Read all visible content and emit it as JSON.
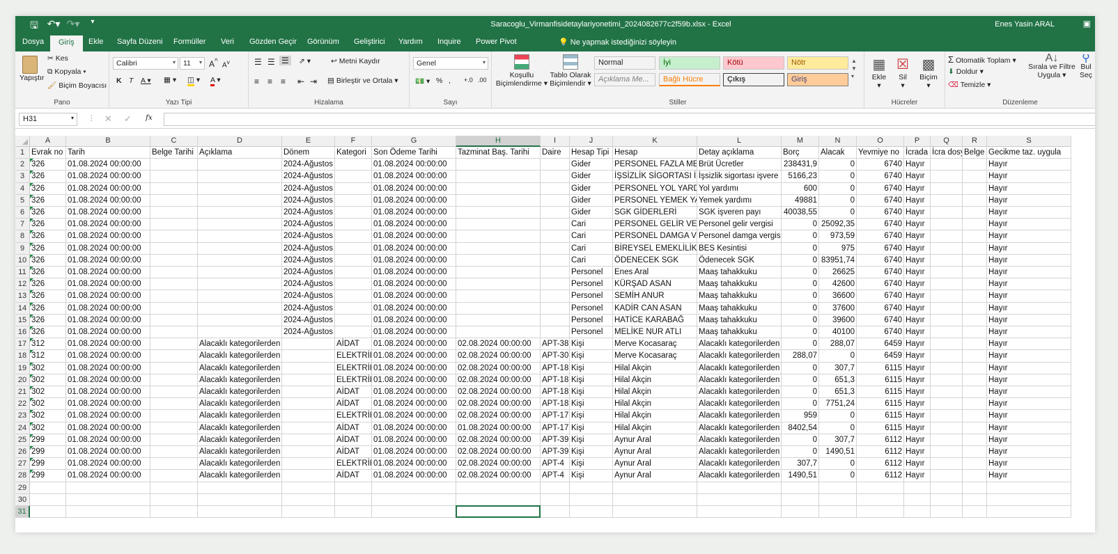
{
  "titlebar": {
    "file_name": "Saracoglu_Virmanfisidetaylariyonetimi_2024082677c2f59b.xlsx  -  Excel",
    "user": "Enes Yasin ARAL"
  },
  "tabs": [
    "Dosya",
    "Giriş",
    "Ekle",
    "Sayfa Düzeni",
    "Formüller",
    "Veri",
    "Gözden Geçir",
    "Görünüm",
    "Geliştirici",
    "Yardım",
    "Inquire",
    "Power Pivot"
  ],
  "active_tab": "Giriş",
  "tell_me": "Ne yapmak istediğinizi söyleyin",
  "ribbon": {
    "clipboard": {
      "paste": "Yapıştır",
      "cut": "Kes",
      "copy": "Kopyala",
      "format_painter": "Biçim Boyacısı",
      "label": "Pano"
    },
    "font": {
      "name": "Calibri",
      "size": "11",
      "label": "Yazı Tipi"
    },
    "alignment": {
      "wrap": "Metni Kaydır",
      "merge": "Birleştir ve Ortala",
      "label": "Hizalama"
    },
    "number": {
      "format": "Genel",
      "label": "Sayı"
    },
    "styles": {
      "conditional": "Koşullu Biçimlendirme",
      "table": "Tablo Olarak Biçimlendir",
      "cells": [
        {
          "text": "Normal",
          "bg": "#ffffff",
          "color": "#000000"
        },
        {
          "text": "İyi",
          "bg": "#c6efce",
          "color": "#006100"
        },
        {
          "text": "Kötü",
          "bg": "#ffc7ce",
          "color": "#9c0006"
        },
        {
          "text": "Nötr",
          "bg": "#ffeb9c",
          "color": "#9c5700"
        },
        {
          "text": "Açıklama Me...",
          "bg": "#ffffff",
          "color": "#7f7f7f"
        },
        {
          "text": "Bağlı Hücre",
          "bg": "#ffffff",
          "color": "#fa7d00"
        },
        {
          "text": "Çıkış",
          "bg": "#f2f2f2",
          "color": "#3f3f3f"
        },
        {
          "text": "Giriş",
          "bg": "#ffcc99",
          "color": "#3f3f76"
        }
      ],
      "label": "Stiller"
    },
    "cells_group": {
      "insert": "Ekle",
      "delete": "Sil",
      "format": "Biçim",
      "label": "Hücreler"
    },
    "editing": {
      "autosum": "Otomatik Toplam",
      "fill": "Doldur",
      "clear": "Temizle",
      "sort": "Sırala ve Filtre Uygula",
      "find": "Bul Seç",
      "label": "Düzenleme"
    }
  },
  "formula_bar": {
    "name_box": "H31",
    "fx": "fx",
    "value": ""
  },
  "sheet": {
    "columns": [
      "A",
      "B",
      "C",
      "D",
      "E",
      "F",
      "G",
      "H",
      "I",
      "J",
      "K",
      "L",
      "M",
      "N",
      "O",
      "P",
      "Q",
      "R",
      "S"
    ],
    "selected_column": "H",
    "selected_row": 31,
    "header_row": [
      "Evrak no",
      "Tarih",
      "Belge Tarihi",
      "Açıklama",
      "Dönem",
      "Kategori",
      "Son Ödeme Tarihi",
      "Tazminat Baş. Tarihi",
      "Daire",
      "Hesap Tipi",
      "Hesap",
      "Detay açıklama",
      "Borç",
      "Alacak",
      "Yevmiye no",
      "İcrada",
      "İcra dosy",
      "Belge",
      "Gecikme taz. uygula"
    ],
    "rows": [
      [
        "326",
        "01.08.2024 00:00:00",
        "",
        "",
        "2024-Ağustos",
        "",
        "01.08.2024 00:00:00",
        "",
        "",
        "Gider",
        "PERSONEL FAZLA MESA",
        "Brüt Ücretler",
        "238431,9",
        "0",
        "6740",
        "Hayır",
        "",
        "",
        "Hayır"
      ],
      [
        "326",
        "01.08.2024 00:00:00",
        "",
        "",
        "2024-Ağustos",
        "",
        "01.08.2024 00:00:00",
        "",
        "",
        "Gider",
        "İŞSİZLİK SİGORTASI İŞV",
        "İşsizlik sigortası işvere",
        "5166,23",
        "0",
        "6740",
        "Hayır",
        "",
        "",
        "Hayır"
      ],
      [
        "326",
        "01.08.2024 00:00:00",
        "",
        "",
        "2024-Ağustos",
        "",
        "01.08.2024 00:00:00",
        "",
        "",
        "Gider",
        "PERSONEL YOL YARDIM",
        "Yol yardımı",
        "600",
        "0",
        "6740",
        "Hayır",
        "",
        "",
        "Hayır"
      ],
      [
        "326",
        "01.08.2024 00:00:00",
        "",
        "",
        "2024-Ağustos",
        "",
        "01.08.2024 00:00:00",
        "",
        "",
        "Gider",
        "PERSONEL YEMEK YAR",
        "Yemek yardımı",
        "49881",
        "0",
        "6740",
        "Hayır",
        "",
        "",
        "Hayır"
      ],
      [
        "326",
        "01.08.2024 00:00:00",
        "",
        "",
        "2024-Ağustos",
        "",
        "01.08.2024 00:00:00",
        "",
        "",
        "Gider",
        "SGK GİDERLERİ",
        "SGK işveren payı",
        "40038,55",
        "0",
        "6740",
        "Hayır",
        "",
        "",
        "Hayır"
      ],
      [
        "326",
        "01.08.2024 00:00:00",
        "",
        "",
        "2024-Ağustos",
        "",
        "01.08.2024 00:00:00",
        "",
        "",
        "Cari",
        "PERSONEL GELİR VERG",
        "Personel gelir vergisi",
        "0",
        "25092,35",
        "6740",
        "Hayır",
        "",
        "",
        "Hayır"
      ],
      [
        "326",
        "01.08.2024 00:00:00",
        "",
        "",
        "2024-Ağustos",
        "",
        "01.08.2024 00:00:00",
        "",
        "",
        "Cari",
        "PERSONEL DAMGA VEF",
        "Personel damga vergis",
        "0",
        "973,59",
        "6740",
        "Hayır",
        "",
        "",
        "Hayır"
      ],
      [
        "326",
        "01.08.2024 00:00:00",
        "",
        "",
        "2024-Ağustos",
        "",
        "01.08.2024 00:00:00",
        "",
        "",
        "Cari",
        "BİREYSEL EMEKLİLİK Sİ",
        "BES Kesintisi",
        "0",
        "975",
        "6740",
        "Hayır",
        "",
        "",
        "Hayır"
      ],
      [
        "326",
        "01.08.2024 00:00:00",
        "",
        "",
        "2024-Ağustos",
        "",
        "01.08.2024 00:00:00",
        "",
        "",
        "Cari",
        "ÖDENECEK SGK",
        "Ödenecek SGK",
        "0",
        "83951,74",
        "6740",
        "Hayır",
        "",
        "",
        "Hayır"
      ],
      [
        "326",
        "01.08.2024 00:00:00",
        "",
        "",
        "2024-Ağustos",
        "",
        "01.08.2024 00:00:00",
        "",
        "",
        "Personel",
        "Enes Aral",
        "Maaş tahakkuku",
        "0",
        "26625",
        "6740",
        "Hayır",
        "",
        "",
        "Hayır"
      ],
      [
        "326",
        "01.08.2024 00:00:00",
        "",
        "",
        "2024-Ağustos",
        "",
        "01.08.2024 00:00:00",
        "",
        "",
        "Personel",
        "KÜRŞAD ASAN",
        "Maaş tahakkuku",
        "0",
        "42600",
        "6740",
        "Hayır",
        "",
        "",
        "Hayır"
      ],
      [
        "326",
        "01.08.2024 00:00:00",
        "",
        "",
        "2024-Ağustos",
        "",
        "01.08.2024 00:00:00",
        "",
        "",
        "Personel",
        "SEMİH ANUR",
        "Maaş tahakkuku",
        "0",
        "36600",
        "6740",
        "Hayır",
        "",
        "",
        "Hayır"
      ],
      [
        "326",
        "01.08.2024 00:00:00",
        "",
        "",
        "2024-Ağustos",
        "",
        "01.08.2024 00:00:00",
        "",
        "",
        "Personel",
        "KADİR CAN ASAN",
        "Maaş tahakkuku",
        "0",
        "37600",
        "6740",
        "Hayır",
        "",
        "",
        "Hayır"
      ],
      [
        "326",
        "01.08.2024 00:00:00",
        "",
        "",
        "2024-Ağustos",
        "",
        "01.08.2024 00:00:00",
        "",
        "",
        "Personel",
        "HATİCE KARABAĞ",
        "Maaş tahakkuku",
        "0",
        "39600",
        "6740",
        "Hayır",
        "",
        "",
        "Hayır"
      ],
      [
        "326",
        "01.08.2024 00:00:00",
        "",
        "",
        "2024-Ağustos",
        "",
        "01.08.2024 00:00:00",
        "",
        "",
        "Personel",
        "MELİKE NUR ATLI",
        "Maaş tahakkuku",
        "0",
        "40100",
        "6740",
        "Hayır",
        "",
        "",
        "Hayır"
      ],
      [
        "312",
        "01.08.2024 00:00:00",
        "",
        "Alacaklı kategorilerden",
        "",
        "AİDAT",
        "01.08.2024 00:00:00",
        "02.08.2024 00:00:00",
        "APT-38",
        "Kişi",
        "Merve Kocasaraç",
        "Alacaklı kategorilerden",
        "0",
        "288,07",
        "6459",
        "Hayır",
        "",
        "",
        "Hayır"
      ],
      [
        "312",
        "01.08.2024 00:00:00",
        "",
        "Alacaklı kategorilerden",
        "",
        "ELEKTRİK",
        "01.08.2024 00:00:00",
        "02.08.2024 00:00:00",
        "APT-30",
        "Kişi",
        "Merve Kocasaraç",
        "Alacaklı kategorilerden",
        "288,07",
        "0",
        "6459",
        "Hayır",
        "",
        "",
        "Hayır"
      ],
      [
        "302",
        "01.08.2024 00:00:00",
        "",
        "Alacaklı kategorilerden",
        "",
        "ELEKTRİK",
        "01.08.2024 00:00:00",
        "02.08.2024 00:00:00",
        "APT-18",
        "Kişi",
        "Hilal Akçin",
        "Alacaklı kategorilerden",
        "0",
        "307,7",
        "6115",
        "Hayır",
        "",
        "",
        "Hayır"
      ],
      [
        "302",
        "01.08.2024 00:00:00",
        "",
        "Alacaklı kategorilerden",
        "",
        "ELEKTRİK",
        "01.08.2024 00:00:00",
        "02.08.2024 00:00:00",
        "APT-18",
        "Kişi",
        "Hilal Akçin",
        "Alacaklı kategorilerden",
        "0",
        "651,3",
        "6115",
        "Hayır",
        "",
        "",
        "Hayır"
      ],
      [
        "302",
        "01.08.2024 00:00:00",
        "",
        "Alacaklı kategorilerden",
        "",
        "AİDAT",
        "01.08.2024 00:00:00",
        "02.08.2024 00:00:00",
        "APT-18",
        "Kişi",
        "Hilal Akçin",
        "Alacaklı kategorilerden",
        "0",
        "651,3",
        "6115",
        "Hayır",
        "",
        "",
        "Hayır"
      ],
      [
        "302",
        "01.08.2024 00:00:00",
        "",
        "Alacaklı kategorilerden",
        "",
        "AİDAT",
        "01.08.2024 00:00:00",
        "02.08.2024 00:00:00",
        "APT-18",
        "Kişi",
        "Hilal Akçin",
        "Alacaklı kategorilerden",
        "0",
        "7751,24",
        "6115",
        "Hayır",
        "",
        "",
        "Hayır"
      ],
      [
        "302",
        "01.08.2024 00:00:00",
        "",
        "Alacaklı kategorilerden",
        "",
        "ELEKTRİK",
        "01.08.2024 00:00:00",
        "02.08.2024 00:00:00",
        "APT-17",
        "Kişi",
        "Hilal Akçin",
        "Alacaklı kategorilerden",
        "959",
        "0",
        "6115",
        "Hayır",
        "",
        "",
        "Hayır"
      ],
      [
        "302",
        "01.08.2024 00:00:00",
        "",
        "Alacaklı kategorilerden",
        "",
        "AİDAT",
        "01.08.2024 00:00:00",
        "01.08.2024 00:00:00",
        "APT-17",
        "Kişi",
        "Hilal Akçin",
        "Alacaklı kategorilerden",
        "8402,54",
        "0",
        "6115",
        "Hayır",
        "",
        "",
        "Hayır"
      ],
      [
        "299",
        "01.08.2024 00:00:00",
        "",
        "Alacaklı kategorilerden",
        "",
        "AİDAT",
        "01.08.2024 00:00:00",
        "02.08.2024 00:00:00",
        "APT-39",
        "Kişi",
        "Aynur Aral",
        "Alacaklı kategorilerden",
        "0",
        "307,7",
        "6112",
        "Hayır",
        "",
        "",
        "Hayır"
      ],
      [
        "299",
        "01.08.2024 00:00:00",
        "",
        "Alacaklı kategorilerden",
        "",
        "AİDAT",
        "01.08.2024 00:00:00",
        "02.08.2024 00:00:00",
        "APT-39",
        "Kişi",
        "Aynur Aral",
        "Alacaklı kategorilerden",
        "0",
        "1490,51",
        "6112",
        "Hayır",
        "",
        "",
        "Hayır"
      ],
      [
        "299",
        "01.08.2024 00:00:00",
        "",
        "Alacaklı kategorilerden",
        "",
        "ELEKTRİK",
        "01.08.2024 00:00:00",
        "02.08.2024 00:00:00",
        "APT-4",
        "Kişi",
        "Aynur Aral",
        "Alacaklı kategorilerden",
        "307,7",
        "0",
        "6112",
        "Hayır",
        "",
        "",
        "Hayır"
      ],
      [
        "299",
        "01.08.2024 00:00:00",
        "",
        "Alacaklı kategorilerden",
        "",
        "AİDAT",
        "01.08.2024 00:00:00",
        "02.08.2024 00:00:00",
        "APT-4",
        "Kişi",
        "Aynur Aral",
        "Alacaklı kategorilerden",
        "1490,51",
        "0",
        "6112",
        "Hayır",
        "",
        "",
        "Hayır"
      ]
    ],
    "empty_rows": [
      29,
      30,
      31
    ],
    "numeric_columns": [
      12,
      13,
      14
    ]
  }
}
